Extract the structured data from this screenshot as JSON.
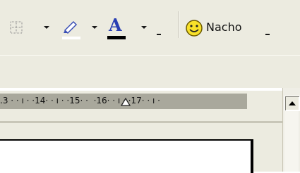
{
  "toolbar": {
    "borders_icon": "borders-icon",
    "highlight_icon": "highlighter-pen-icon",
    "highlight_color": "#ffffff",
    "font_color_glyph": "A",
    "font_color_icon": "font-color-icon",
    "font_color_bar": "#000000",
    "smiley_icon": "smiley-face-icon",
    "user_label": "Nacho"
  },
  "ruler": {
    "text": ".3 · · ı · ·14· · ı · ·15· ·  ·16· · ı · ·17· · ı ·"
  },
  "scrollbar": {
    "up_icon": "scroll-up-arrow-icon"
  }
}
